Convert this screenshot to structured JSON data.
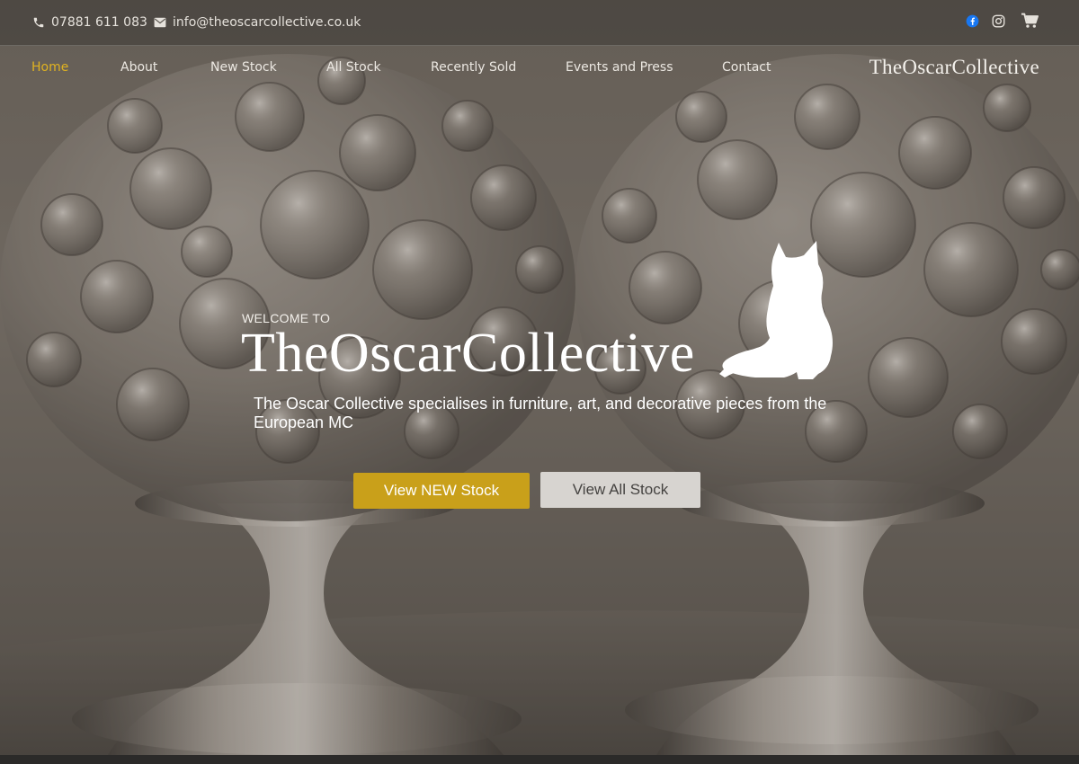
{
  "topbar": {
    "phone": "07881 611 083",
    "email": "info@theoscarcollective.co.uk",
    "icons": [
      "phone-icon",
      "envelope-icon",
      "facebook-icon",
      "instagram-icon",
      "cart-icon"
    ]
  },
  "nav": {
    "items": [
      {
        "label": "Home",
        "active": true
      },
      {
        "label": "About"
      },
      {
        "label": "New Stock"
      },
      {
        "label": "All Stock"
      },
      {
        "label": "Recently Sold"
      },
      {
        "label": "Events and Press"
      },
      {
        "label": "Contact"
      }
    ],
    "logo": "TheOscarCollective"
  },
  "hero": {
    "welcome": "WELCOME TO",
    "title": "TheOscarCollective",
    "tagline": "The Oscar Collective specialises in furniture, art, and decorative pieces from the European MC",
    "primary_button": "View NEW Stock",
    "secondary_button": "View All Stock"
  },
  "colors": {
    "accent": "#c9a01a",
    "active_nav": "#e0b221",
    "secondary_button": "#d7d4d0",
    "facebook": "#1877f2"
  }
}
